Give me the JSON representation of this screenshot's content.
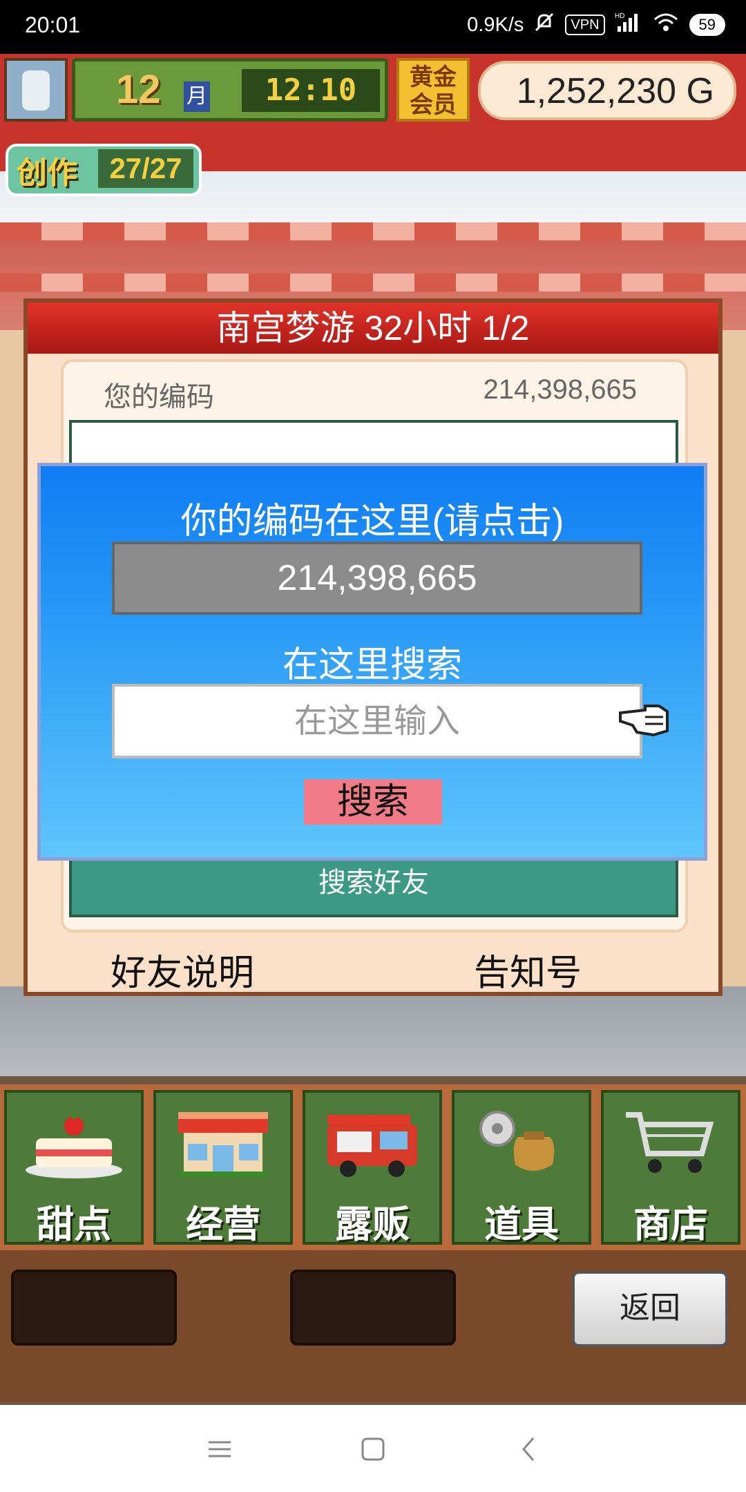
{
  "status_bar": {
    "time": "20:01",
    "net_speed": "0.9K/s",
    "vpn": "VPN",
    "hd": "HD",
    "battery": "59"
  },
  "hud": {
    "month_number": "12",
    "month_label": "月",
    "clock": "12:10",
    "gold_badge": "黄金会员",
    "money": "1,252,230 G",
    "create_label": "创作",
    "create_count": "27/27"
  },
  "panel": {
    "title": "南宫梦游  32小时 1/2",
    "code_label": "您的编码",
    "code_value": "214,398,665",
    "search_friend": "搜索好友",
    "friend_help": "好友说明",
    "notice": "告知号"
  },
  "dialog": {
    "title": "你的编码在这里(请点击)",
    "code": "214,398,665",
    "search_heading": "在这里搜索",
    "search_placeholder": "在这里输入",
    "search_button": "搜索"
  },
  "menu": {
    "items": [
      {
        "label": "甜点",
        "icon": "cake-icon"
      },
      {
        "label": "经营",
        "icon": "shop-building-icon"
      },
      {
        "label": "露贩",
        "icon": "food-truck-icon"
      },
      {
        "label": "道具",
        "icon": "item-bag-icon"
      },
      {
        "label": "商店",
        "icon": "shopping-cart-icon"
      }
    ],
    "back": "返回"
  },
  "colors": {
    "dialog_top": "#0f7df4",
    "dialog_bottom": "#5ec6fb",
    "title_bar": "#d2221c",
    "search_button": "#f07a86"
  }
}
